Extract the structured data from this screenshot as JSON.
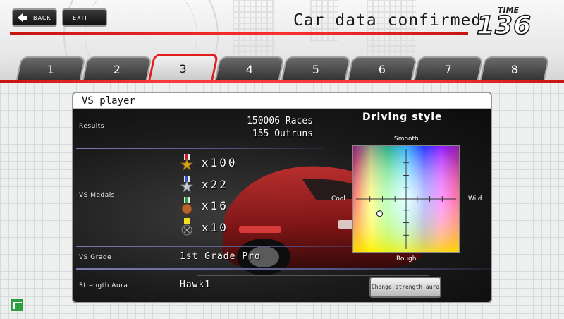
{
  "header": {
    "back_label": "BACK",
    "exit_label": "EXIT",
    "title": "Car data confirmed",
    "time_label": "TIME",
    "time_value": "136"
  },
  "tabs": [
    {
      "label": "1",
      "active": false
    },
    {
      "label": "2",
      "active": false
    },
    {
      "label": "3",
      "active": true
    },
    {
      "label": "4",
      "active": false
    },
    {
      "label": "5",
      "active": false
    },
    {
      "label": "6",
      "active": false
    },
    {
      "label": "7",
      "active": false
    },
    {
      "label": "8",
      "active": false
    }
  ],
  "panel": {
    "title": "VS player",
    "results": {
      "label": "Results",
      "races": "150006 Races",
      "outruns": "155 Outruns"
    },
    "medals": {
      "label": "VS Medals",
      "items": [
        {
          "icon": "gold-medal-icon",
          "count": "x100",
          "color": "#d9a520"
        },
        {
          "icon": "silver-medal-icon",
          "count": "x22",
          "color": "#c8ccd4"
        },
        {
          "icon": "bronze-medal-icon",
          "count": "x16",
          "color": "#b5652e"
        },
        {
          "icon": "black-medal-icon",
          "count": "x10",
          "color": "#333333"
        }
      ]
    },
    "grade": {
      "label": "VS Grade",
      "value": "1st Grade Pro"
    },
    "aura": {
      "label": "Strength Aura",
      "value": "Hawk1"
    },
    "driving_style": {
      "title": "Driving style",
      "top_label": "Smooth",
      "bottom_label": "Rough",
      "left_label": "Cool",
      "right_label": "Wild"
    },
    "change_button": "Change strength aura"
  },
  "colors": {
    "accent_red": "#e01e1e",
    "panel_dark": "#1a1a1a",
    "separator": "#7b7bb0"
  }
}
